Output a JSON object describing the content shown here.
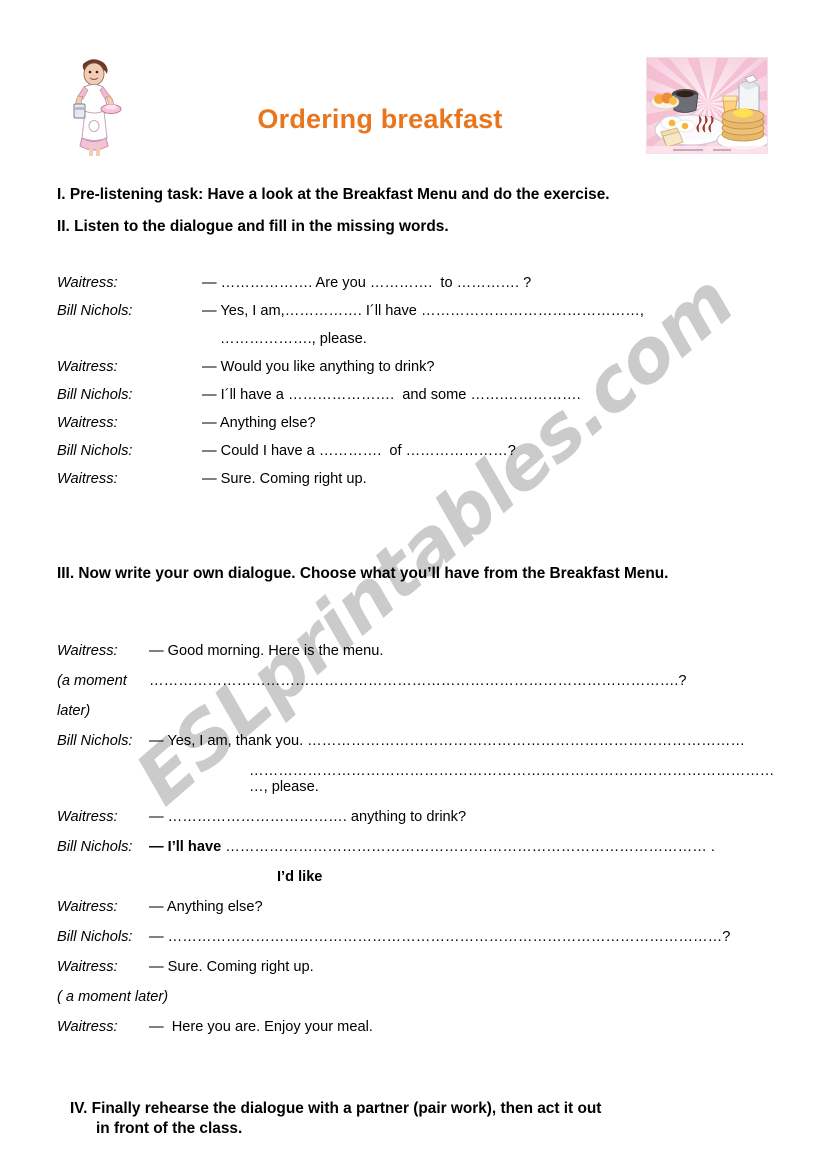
{
  "header": {
    "title": "Ordering breakfast",
    "title_color": "#e8761e",
    "waitress_icon": "waitress-clipart",
    "breakfast_icon": "breakfast-foods-clipart"
  },
  "watermark": {
    "text": "ESLprintables.com",
    "color": "#c9c9c9"
  },
  "headings": {
    "section_1": "I. Pre-listening task: Have a look at the Breakfast Menu and do the exercise.",
    "section_2": "II. Listen to the dialogue and fill in the missing words.",
    "section_3": "III. Now write your own dialogue. Choose what you’ll have from the Breakfast Menu.",
    "section_4_line1": "IV.  Finally rehearse the dialogue with a partner (pair work), then act it out",
    "section_4_line2": "in front of the class."
  },
  "dialogue_1": {
    "rows": [
      {
        "speaker": "Waitress:",
        "text": "— ………………. Are you ………….  to …………. ?"
      },
      {
        "speaker": "Bill Nichols:",
        "text": "— Yes, I am,……………. I´ll have ………………………………………,"
      },
      {
        "speaker": "",
        "text": "………………., please."
      },
      {
        "speaker": "Waitress:",
        "text": "— Would you like anything to drink?"
      },
      {
        "speaker": "Bill Nichols:",
        "text": "— I´ll have a ………………….  and some …….……………."
      },
      {
        "speaker": "Waitress:",
        "text": "— Anything else?"
      },
      {
        "speaker": "Bill Nichols:",
        "text": "— Could I have a ………….  of …………………?"
      },
      {
        "speaker": "Waitress:",
        "text": "— Sure. Coming right up."
      }
    ]
  },
  "dialogue_2": {
    "rows": [
      {
        "speaker": "Waitress:",
        "text": "— Good morning. Here is the menu."
      },
      {
        "speaker": "(a moment",
        "text": "……………………………………………………………………………………………….?"
      },
      {
        "speaker": "later)",
        "text": ""
      },
      {
        "speaker": "Bill Nichols:",
        "text": "— Yes, I am, thank you. ………………………………………………………………………………"
      },
      {
        "speaker": "",
        "text": "…………………………………………………………………………………………………, please."
      },
      {
        "speaker": "Waitress:",
        "text": "— ………………………………. anything to drink?"
      },
      {
        "speaker": "Bill Nichols:",
        "bold_lead": "— I’ll have",
        "text": " ……………………………………………………………………………………… ."
      },
      {
        "speaker": "",
        "text": "I’d like"
      },
      {
        "speaker": "Waitress:",
        "text": "— Anything else?"
      },
      {
        "speaker": "Bill Nichols:",
        "text": "— ……………………………………………………………………………………………………?"
      },
      {
        "speaker": "Waitress:",
        "text": "— Sure. Coming right up."
      },
      {
        "speaker": "( a moment later)",
        "text": ""
      },
      {
        "speaker": "Waitress:",
        "text": "—  Here you are. Enjoy your meal."
      }
    ]
  }
}
